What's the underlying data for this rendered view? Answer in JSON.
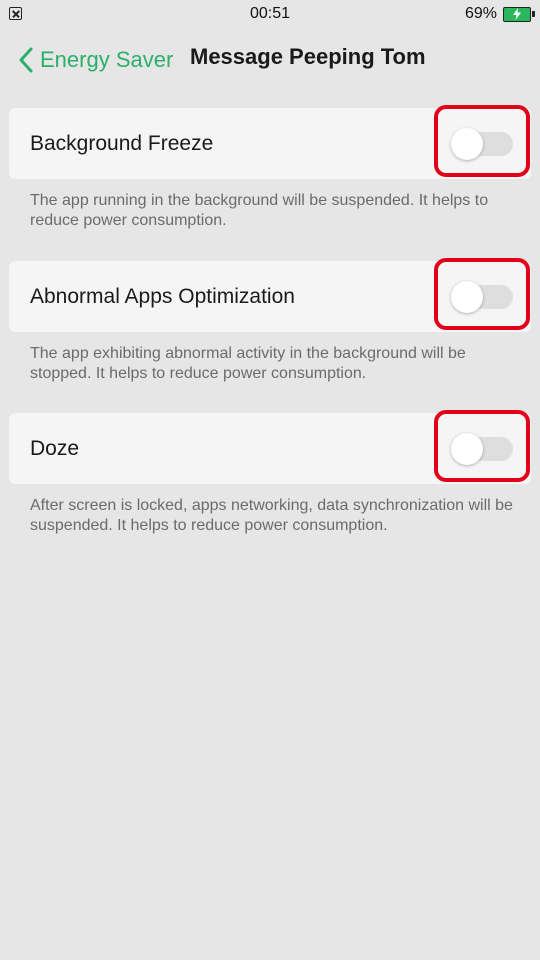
{
  "status_bar": {
    "time": "00:51",
    "battery_percent": "69%",
    "battery_level": 0.69,
    "left_icon": "notification-x-icon",
    "battery_icon": "battery-charging-icon"
  },
  "header": {
    "back_label": "Energy Saver",
    "back_icon": "chevron-left-icon",
    "title": "Message Peeping Tom",
    "accent_color": "#2bb06a"
  },
  "settings": [
    {
      "label": "Background Freeze",
      "description": "The app running in the background will be suspended. It helps to reduce power consumption.",
      "enabled": false
    },
    {
      "label": "Abnormal Apps Optimization",
      "description": "The app exhibiting abnormal activity in the background will be stopped. It helps to reduce power consumption.",
      "enabled": false
    },
    {
      "label": "Doze",
      "description": "After screen is locked, apps networking, data synchronization will be suspended. It helps to reduce power consumption.",
      "enabled": false
    }
  ],
  "colors": {
    "highlight": "#e3001b",
    "background": "#e6e6e6",
    "card": "#f5f5f5"
  }
}
